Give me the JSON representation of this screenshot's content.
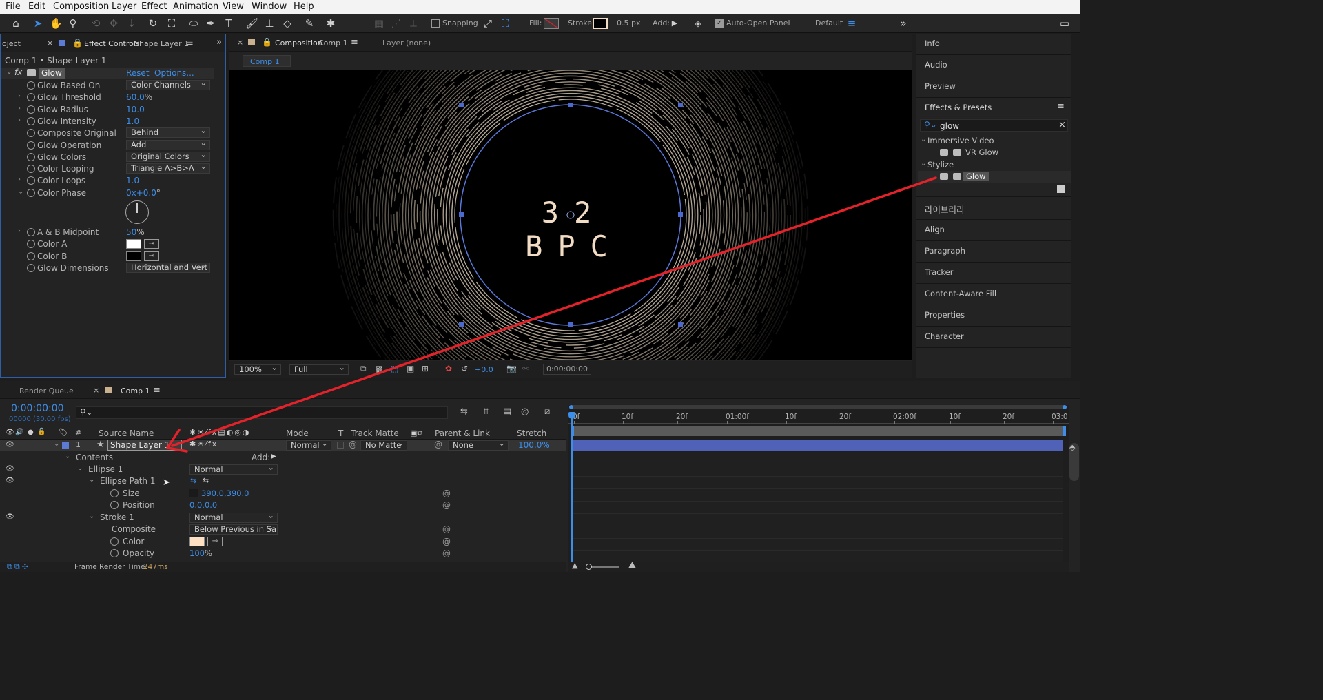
{
  "menu": [
    "File",
    "Edit",
    "Composition",
    "Layer",
    "Effect",
    "Animation",
    "View",
    "Window",
    "Help"
  ],
  "toolbar": {
    "snapping": "Snapping",
    "fill": "Fill:",
    "stroke": "Stroke:",
    "stroke_width": "0.5 px",
    "add": "Add:",
    "auto_open": "Auto-Open Panel",
    "workspace": "Default",
    "fill_color": "#8a2a2a",
    "stroke_color": "#f2dcc4"
  },
  "left_panel": {
    "tab_project": "oject",
    "tab_effect_controls": "Effect Controls",
    "tab_layer": "Shape Layer 1",
    "breadcrumb": "Comp 1 • Shape Layer 1",
    "effect_name": "Glow",
    "reset": "Reset",
    "options": "Options...",
    "props": [
      {
        "label": "Glow Based On",
        "type": "dropdown",
        "value": "Color Channels"
      },
      {
        "label": "Glow Threshold",
        "type": "value",
        "value": "60.0",
        "suffix": "%"
      },
      {
        "label": "Glow Radius",
        "type": "value",
        "value": "10.0"
      },
      {
        "label": "Glow Intensity",
        "type": "value",
        "value": "1.0"
      },
      {
        "label": "Composite Original",
        "type": "dropdown",
        "value": "Behind"
      },
      {
        "label": "Glow Operation",
        "type": "dropdown",
        "value": "Add"
      },
      {
        "label": "Glow Colors",
        "type": "dropdown",
        "value": "Original Colors"
      },
      {
        "label": "Color Looping",
        "type": "dropdown",
        "value": "Triangle A>B>A"
      },
      {
        "label": "Color Loops",
        "type": "value",
        "value": "1.0"
      },
      {
        "label": "Color Phase",
        "type": "value",
        "value": "0x+0.0",
        "suffix": "°"
      }
    ],
    "props2": [
      {
        "label": "A & B Midpoint",
        "type": "value",
        "value": "50",
        "suffix": "%"
      },
      {
        "label": "Color A",
        "type": "color",
        "value": "#ffffff"
      },
      {
        "label": "Color B",
        "type": "color",
        "value": "#000000"
      },
      {
        "label": "Glow Dimensions",
        "type": "dropdown",
        "value": "Horizontal and Vert"
      }
    ]
  },
  "comp_panel": {
    "tab_label": "Composition",
    "tab_comp": "Comp 1",
    "layer_tab": "Layer (none)",
    "sub_tab": "Comp 1",
    "canvas_text": "32 BPC",
    "zoom": "100%",
    "resolution": "Full",
    "exposure": "+0.0",
    "timecode": "0:00:00:00"
  },
  "right_panel": {
    "top_items": [
      "Info",
      "Audio",
      "Preview"
    ],
    "effects_presets": "Effects & Presets",
    "search_value": "glow",
    "groups": [
      {
        "name": "Immersive Video",
        "items": [
          "VR Glow"
        ]
      },
      {
        "name": "Stylize",
        "items": [
          "Glow"
        ]
      }
    ],
    "bottom_items": [
      "라이브러리",
      "Align",
      "Paragraph",
      "Tracker",
      "Content-Aware Fill",
      "Properties",
      "Character"
    ]
  },
  "timeline": {
    "tab_render": "Render Queue",
    "tab_comp": "Comp 1",
    "timecode": "0:00:00:00",
    "fps": "00000 (30.00 fps)",
    "headers": {
      "source_name": "Source Name",
      "mode": "Mode",
      "t": "T",
      "track_matte": "Track Matte",
      "parent": "Parent & Link",
      "stretch": "Stretch",
      "num": "#"
    },
    "layer": {
      "num": "1",
      "name": "Shape Layer 1",
      "mode": "Normal",
      "matte": "No Matte",
      "parent": "None",
      "stretch": "100.0%"
    },
    "rows": {
      "contents": "Contents",
      "add": "Add:",
      "ellipse1": "Ellipse 1",
      "ellipse1_mode": "Normal",
      "ellipse_path": "Ellipse Path 1",
      "size": "Size",
      "size_val": "390.0,390.0",
      "position": "Position",
      "position_val": "0.0,0.0",
      "stroke1": "Stroke 1",
      "stroke1_mode": "Normal",
      "composite": "Composite",
      "composite_val": "Below Previous in Sa",
      "color": "Color",
      "opacity": "Opacity",
      "opacity_val": "100",
      "opacity_suffix": "%"
    },
    "ruler": [
      "0f",
      "10f",
      "20f",
      "01:00f",
      "10f",
      "20f",
      "02:00f",
      "10f",
      "20f",
      "03:0"
    ],
    "footer": "Frame Render Time:",
    "footer_val": "247ms"
  }
}
